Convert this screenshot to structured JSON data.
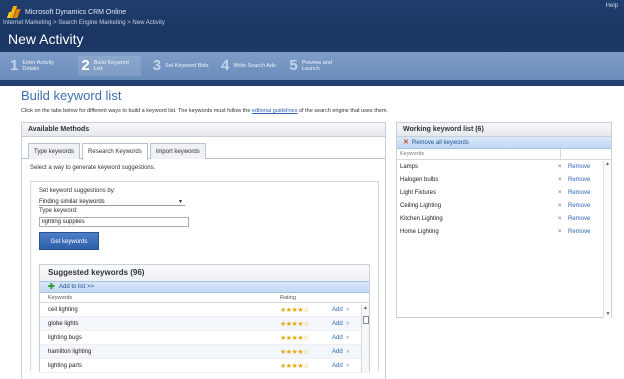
{
  "header": {
    "app_title": "Microsoft Dynamics CRM Online",
    "help": "Help",
    "breadcrumbs": "Internet Marketing > Search Engine Marketing > New Activity",
    "page_title": "New Activity"
  },
  "steps": [
    {
      "num": "1",
      "label": "Enter Activity Details"
    },
    {
      "num": "2",
      "label": "Build Keyword List"
    },
    {
      "num": "3",
      "label": "Set Keyword Bids"
    },
    {
      "num": "4",
      "label": "Write Search Ads"
    },
    {
      "num": "5",
      "label": "Preview and Launch"
    }
  ],
  "main": {
    "title": "Build keyword list",
    "intro_before": "Click on the tabs below for different ways to build a keyword list. The keywords must follow the ",
    "intro_link": "editorial guidelines",
    "intro_after": " of the search engine that uses them."
  },
  "available": {
    "title": "Available Methods",
    "tabs": [
      "Type keywords",
      "Research Keywords",
      "Import keywords"
    ],
    "hint": "Select a way to generate keyword suggestions.",
    "suggest_label": "Set keyword suggestions by:",
    "suggest_value": "Finding similar keywords",
    "type_label": "Type keyword:",
    "type_value": "lighting supplies",
    "get_button": "Get keywords"
  },
  "suggested": {
    "title": "Suggested keywords (96)",
    "add_to_list": "Add to list >>",
    "col_keywords": "Keywords",
    "col_rating": "Rating",
    "add_label": "Add",
    "chevron": "»",
    "rows": [
      {
        "keyword": "ceil lighting",
        "stars": "★★★★☆"
      },
      {
        "keyword": "globe lights",
        "stars": "★★★★☆"
      },
      {
        "keyword": "lighting bugs",
        "stars": "★★★★☆"
      },
      {
        "keyword": "hamilton lighting",
        "stars": "★★★★☆"
      },
      {
        "keyword": "lighting parts",
        "stars": "★★★★☆"
      }
    ]
  },
  "working": {
    "title": "Working keyword list (6)",
    "remove_all": "Remove all keywords",
    "col_keywords": "Keywords",
    "remove_label": "Remove",
    "x_glyph": "×",
    "rows": [
      "Lamps",
      "Halogen bulbs",
      "Light Fixtures",
      "Ceiling Lighting",
      "Kitchen Lighting",
      "Home Lighting"
    ]
  },
  "colors": {
    "header_bg": "#1f3d6e",
    "steps_bg": "#7e9dc7",
    "accent_blue": "#2a66b8",
    "star_gold": "#e6a817"
  }
}
